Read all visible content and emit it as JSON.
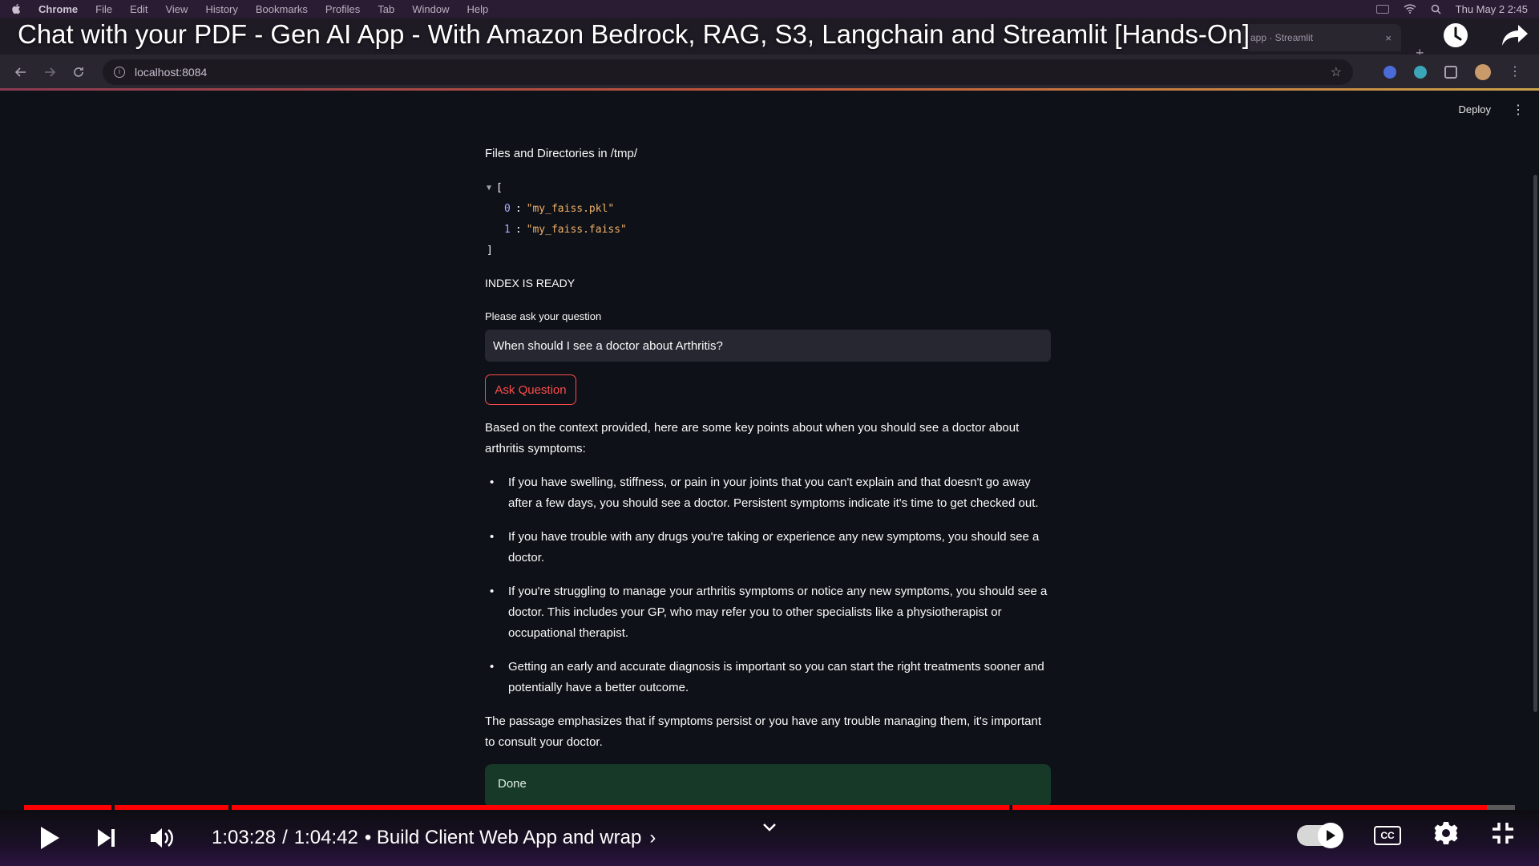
{
  "mac_menubar": {
    "items": [
      "Chrome",
      "File",
      "Edit",
      "View",
      "History",
      "Bookmarks",
      "Profiles",
      "Tab",
      "Window",
      "Help"
    ],
    "clock": "Thu May 2  2:45"
  },
  "video": {
    "title": "Chat with your PDF - Gen AI App - With Amazon Bedrock, RAG, S3, Langchain and Streamlit [Hands-On]",
    "current_time": "1:03:28",
    "time_separator": "/",
    "duration": "1:04:42",
    "chapter": "• Build Client Web App and wrap",
    "chapter_chevron": "›",
    "progress_fraction": 0.981
  },
  "browser": {
    "tab_title": "app · Streamlit",
    "tab_close": "×",
    "new_tab": "+",
    "url": "localhost:8084"
  },
  "streamlit": {
    "deploy_label": "Deploy",
    "files_label": "Files and Directories in /tmp/",
    "json_open": "[",
    "json_close": "]",
    "json_items": [
      {
        "index": "0",
        "value": "\"my_faiss.pkl\""
      },
      {
        "index": "1",
        "value": "\"my_faiss.faiss\""
      }
    ],
    "index_status": "INDEX IS READY",
    "question_label": "Please ask your question",
    "question_value": "When should I see a doctor about Arthritis?",
    "ask_button": "Ask Question",
    "answer_intro": "Based on the context provided, here are some key points about when you should see a doctor about arthritis symptoms:",
    "answer_bullets": [
      "If you have swelling, stiffness, or pain in your joints that you can't explain and that doesn't go away after a few days, you should see a doctor. Persistent symptoms indicate it's time to get checked out.",
      "If you have trouble with any drugs you're taking or experience any new symptoms, you should see a doctor.",
      "If you're struggling to manage your arthritis symptoms or notice any new symptoms, you should see a doctor. This includes your GP, who may refer you to other specialists like a physiotherapist or occupational therapist.",
      "Getting an early and accurate diagnosis is important so you can start the right treatments sooner and potentially have a better outcome."
    ],
    "answer_outro": "The passage emphasizes that if symptoms persist or you have any trouble managing them, it's important to consult your doctor.",
    "done_label": "Done"
  },
  "icons": {
    "apple": "apple-logo-icon",
    "watch_later": "clock-icon",
    "share": "share-arrow-icon",
    "play": "play-icon",
    "next": "skip-next-icon",
    "volume": "volume-icon",
    "settings": "gear-icon",
    "exit_fullscreen": "exit-fullscreen-icon",
    "captions": "CC"
  },
  "colors": {
    "streamlit_bg": "#0e1117",
    "primary_red": "#ff4b4b",
    "success_bg": "#173928",
    "youtube_red": "#ff0000"
  }
}
